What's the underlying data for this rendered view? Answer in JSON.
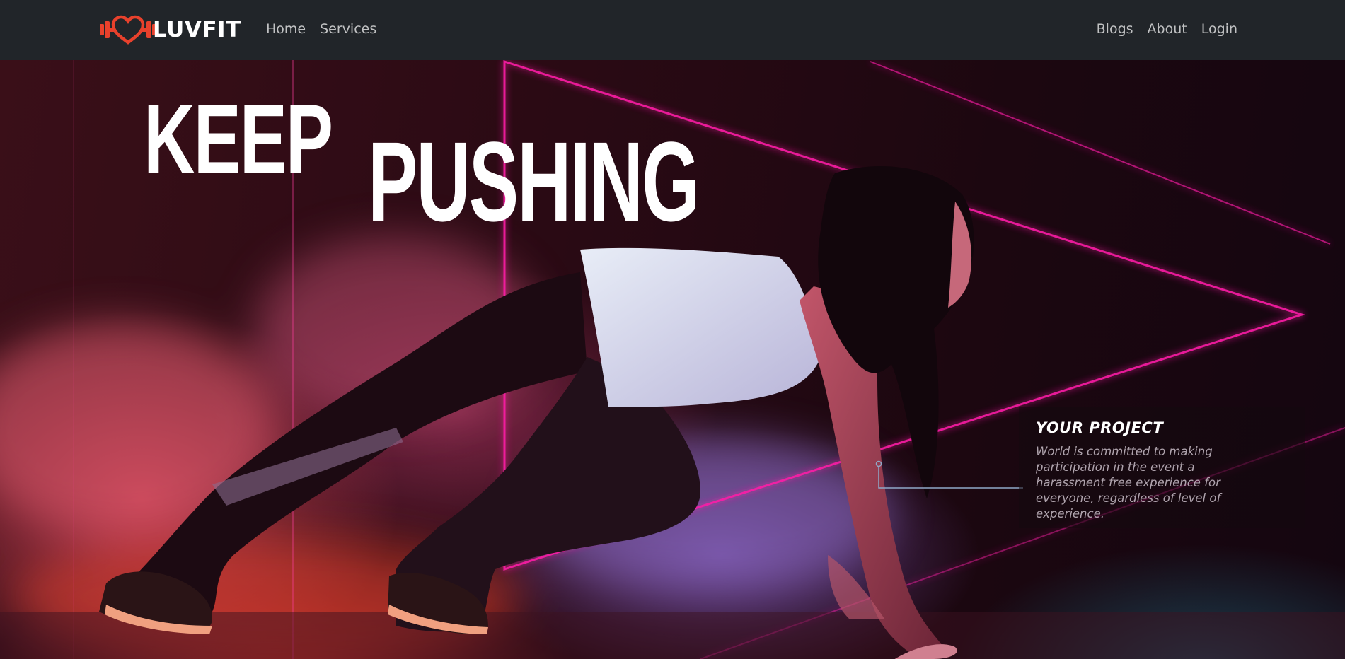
{
  "brand": {
    "name": "LUVFIT",
    "logo_icon": "heart-dumbbell-icon",
    "accent": "#e8412c"
  },
  "nav": {
    "left": [
      {
        "label": "Home"
      },
      {
        "label": "Services"
      }
    ],
    "right": [
      {
        "label": "Blogs"
      },
      {
        "label": "About"
      },
      {
        "label": "Login"
      }
    ]
  },
  "hero": {
    "headline_word1": "KEEP",
    "headline_word2": "PUSHING",
    "neon_color": "#ff1fa8",
    "project": {
      "title": "YOUR PROJECT",
      "text": "World is committed to making participation in the event a harassment free experience for everyone, regardless of level of experience."
    }
  }
}
